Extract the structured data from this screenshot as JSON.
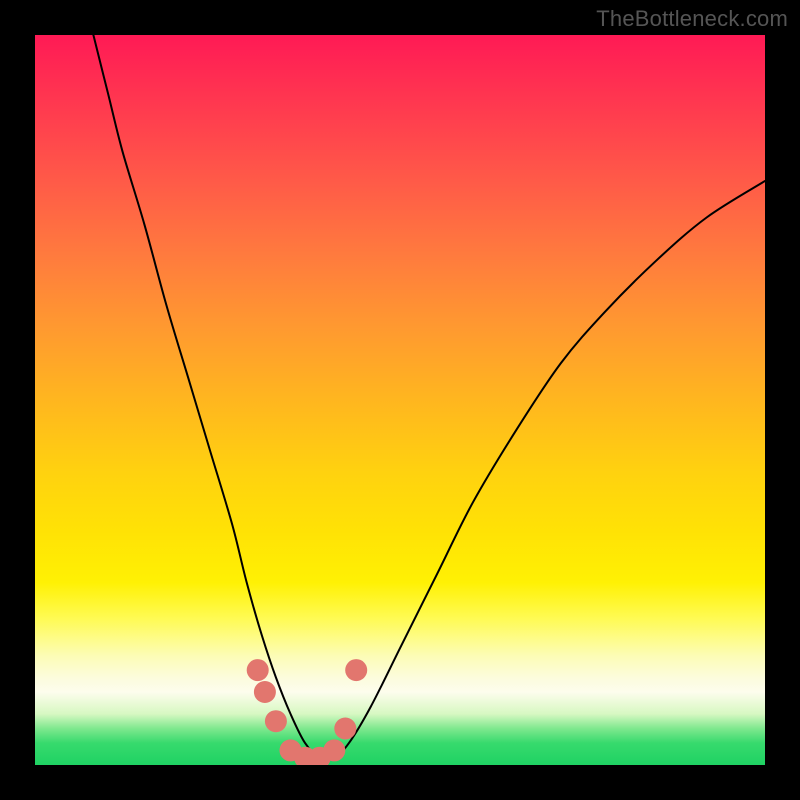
{
  "watermark": "TheBottleneck.com",
  "chart_data": {
    "type": "line",
    "title": "",
    "xlabel": "",
    "ylabel": "",
    "xlim": [
      0,
      100
    ],
    "ylim": [
      0,
      100
    ],
    "series": [
      {
        "name": "bottleneck-curve",
        "x": [
          8,
          10,
          12,
          15,
          18,
          21,
          24,
          27,
          29,
          31,
          33,
          35,
          37,
          39,
          41,
          43,
          46,
          50,
          55,
          60,
          66,
          72,
          78,
          85,
          92,
          100
        ],
        "y": [
          100,
          92,
          84,
          74,
          63,
          53,
          43,
          33,
          25,
          18,
          12,
          7,
          3,
          1,
          1,
          3,
          8,
          16,
          26,
          36,
          46,
          55,
          62,
          69,
          75,
          80
        ]
      }
    ],
    "markers": {
      "name": "highlight-points",
      "color": "#e2766e",
      "points": [
        {
          "x": 30.5,
          "y": 13
        },
        {
          "x": 31.5,
          "y": 10
        },
        {
          "x": 33.0,
          "y": 6
        },
        {
          "x": 35.0,
          "y": 2
        },
        {
          "x": 37.0,
          "y": 1
        },
        {
          "x": 39.0,
          "y": 1
        },
        {
          "x": 41.0,
          "y": 2
        },
        {
          "x": 42.5,
          "y": 5
        },
        {
          "x": 44.0,
          "y": 13
        }
      ]
    }
  }
}
